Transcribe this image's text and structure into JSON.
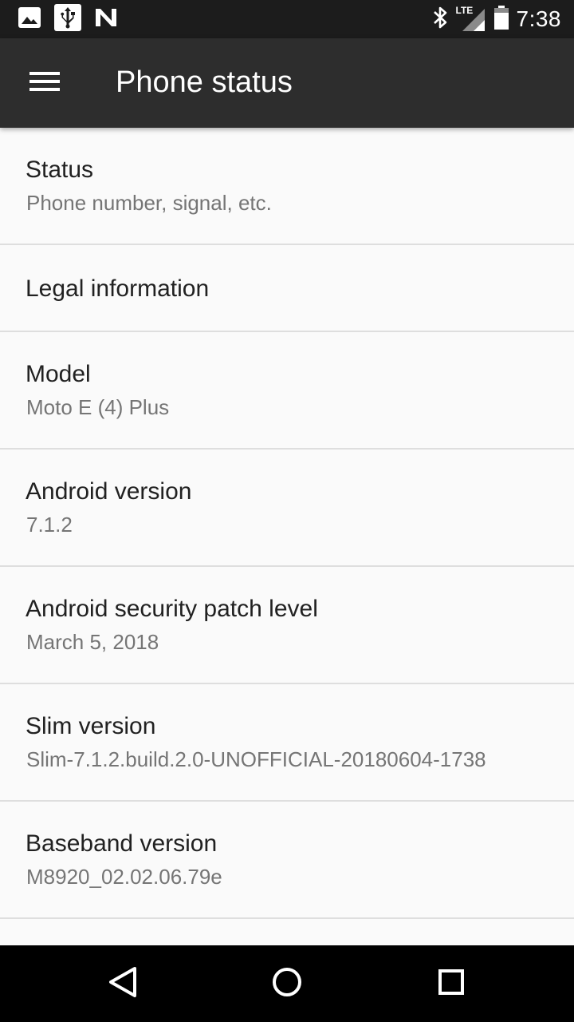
{
  "status_bar": {
    "time": "7:38",
    "network_label": "LTE",
    "icons_left": [
      "image-icon",
      "usb-icon",
      "n-icon"
    ],
    "icons_right": [
      "bluetooth-icon",
      "signal-icon",
      "battery-icon"
    ]
  },
  "app_bar": {
    "title": "Phone status",
    "menu_icon": "hamburger-menu-icon"
  },
  "items": [
    {
      "title": "Status",
      "subtitle": "Phone number, signal, etc."
    },
    {
      "title": "Legal information",
      "subtitle": ""
    },
    {
      "title": "Model",
      "subtitle": "Moto E (4) Plus"
    },
    {
      "title": "Android version",
      "subtitle": "7.1.2"
    },
    {
      "title": "Android security patch level",
      "subtitle": "March 5, 2018"
    },
    {
      "title": "Slim version",
      "subtitle": "Slim-7.1.2.build.2.0-UNOFFICIAL-20180604-1738"
    },
    {
      "title": "Baseband version",
      "subtitle": "M8920_02.02.06.79e"
    }
  ],
  "nav_bar": {
    "icons": [
      "back-icon",
      "home-icon",
      "recents-icon"
    ]
  }
}
